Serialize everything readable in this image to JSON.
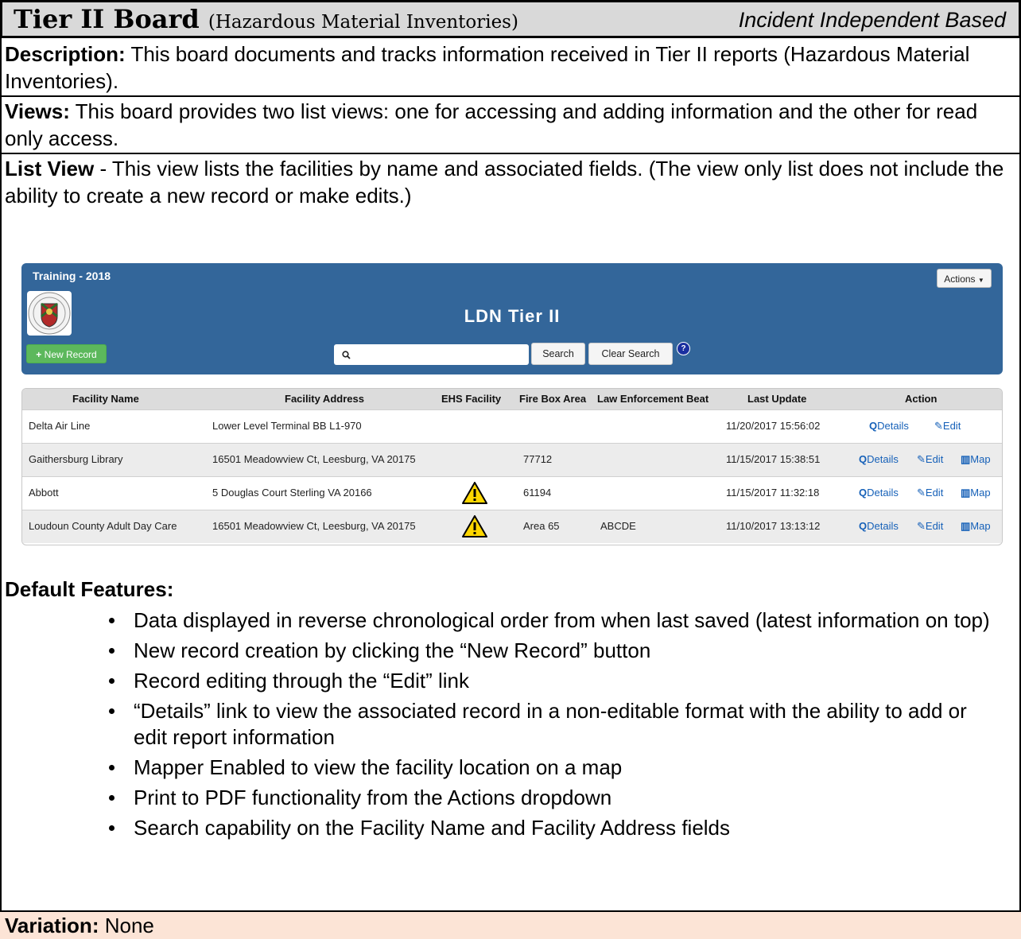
{
  "title": {
    "main": "Tier II Board",
    "sub": "(Hazardous Material Inventories)",
    "right": "Incident Independent Based"
  },
  "description": {
    "label": "Description:",
    "text": "This board documents and tracks information received in Tier II reports (Hazardous Material Inventories)."
  },
  "views": {
    "label": "Views:",
    "text": "This board provides two list views: one for accessing and adding information and the other for read only access."
  },
  "list_view": {
    "label": "List View",
    "text": "- This view lists the facilities by name and associated fields. (The view only list does not include the ability to create a new record or make edits.)"
  },
  "app": {
    "brand": "Training - 2018",
    "actions_label": "Actions",
    "title": "LDN Tier II",
    "new_record_label": "New Record",
    "search_value": "",
    "search_button": "Search",
    "clear_button": "Clear Search",
    "help_glyph": "?"
  },
  "table": {
    "headers": [
      "Facility Name",
      "Facility Address",
      "EHS Facility",
      "Fire Box Area",
      "Law Enforcement Beat",
      "Last Update",
      "Action"
    ],
    "rows": [
      {
        "name": "Delta Air Line",
        "address": "Lower Level Terminal BB L1-970",
        "ehs": false,
        "firebox": "",
        "beat": "",
        "updated": "11/20/2017 15:56:02",
        "details": "Details",
        "edit": "Edit",
        "map": ""
      },
      {
        "name": "Gaithersburg Library",
        "address": "16501 Meadowview Ct, Leesburg, VA 20175",
        "ehs": false,
        "firebox": "77712",
        "beat": "",
        "updated": "11/15/2017 15:38:51",
        "details": "Details",
        "edit": "Edit",
        "map": "Map"
      },
      {
        "name": "Abbott",
        "address": "5 Douglas Court Sterling VA 20166",
        "ehs": true,
        "firebox": "61194",
        "beat": "",
        "updated": "11/15/2017 11:32:18",
        "details": "Details",
        "edit": "Edit",
        "map": "Map"
      },
      {
        "name": "Loudoun County Adult Day Care",
        "address": "16501 Meadowview Ct, Leesburg, VA 20175",
        "ehs": true,
        "firebox": "Area 65",
        "beat": "ABCDE",
        "updated": "11/10/2017 13:13:12",
        "details": "Details",
        "edit": "Edit",
        "map": "Map"
      }
    ]
  },
  "features": {
    "heading": "Default Features:",
    "items": [
      "Data displayed in reverse chronological order from when last saved (latest information on top)",
      "New record creation by clicking the “New Record” button",
      "Record editing through the “Edit” link",
      "“Details” link to view the associated record in a non-editable format with the ability to add or edit report information",
      "Mapper Enabled to view the facility location on a map",
      "Print to PDF functionality from the Actions dropdown",
      "Search capability on the Facility Name and Facility Address fields"
    ]
  },
  "variation": {
    "label": "Variation:",
    "text": "None"
  },
  "colors": {
    "header_bg": "#33669a",
    "new_record_green": "#5cb85c",
    "link_blue": "#1560b8",
    "variation_bg": "#fce4d6",
    "warning_yellow": "#ffd700"
  }
}
